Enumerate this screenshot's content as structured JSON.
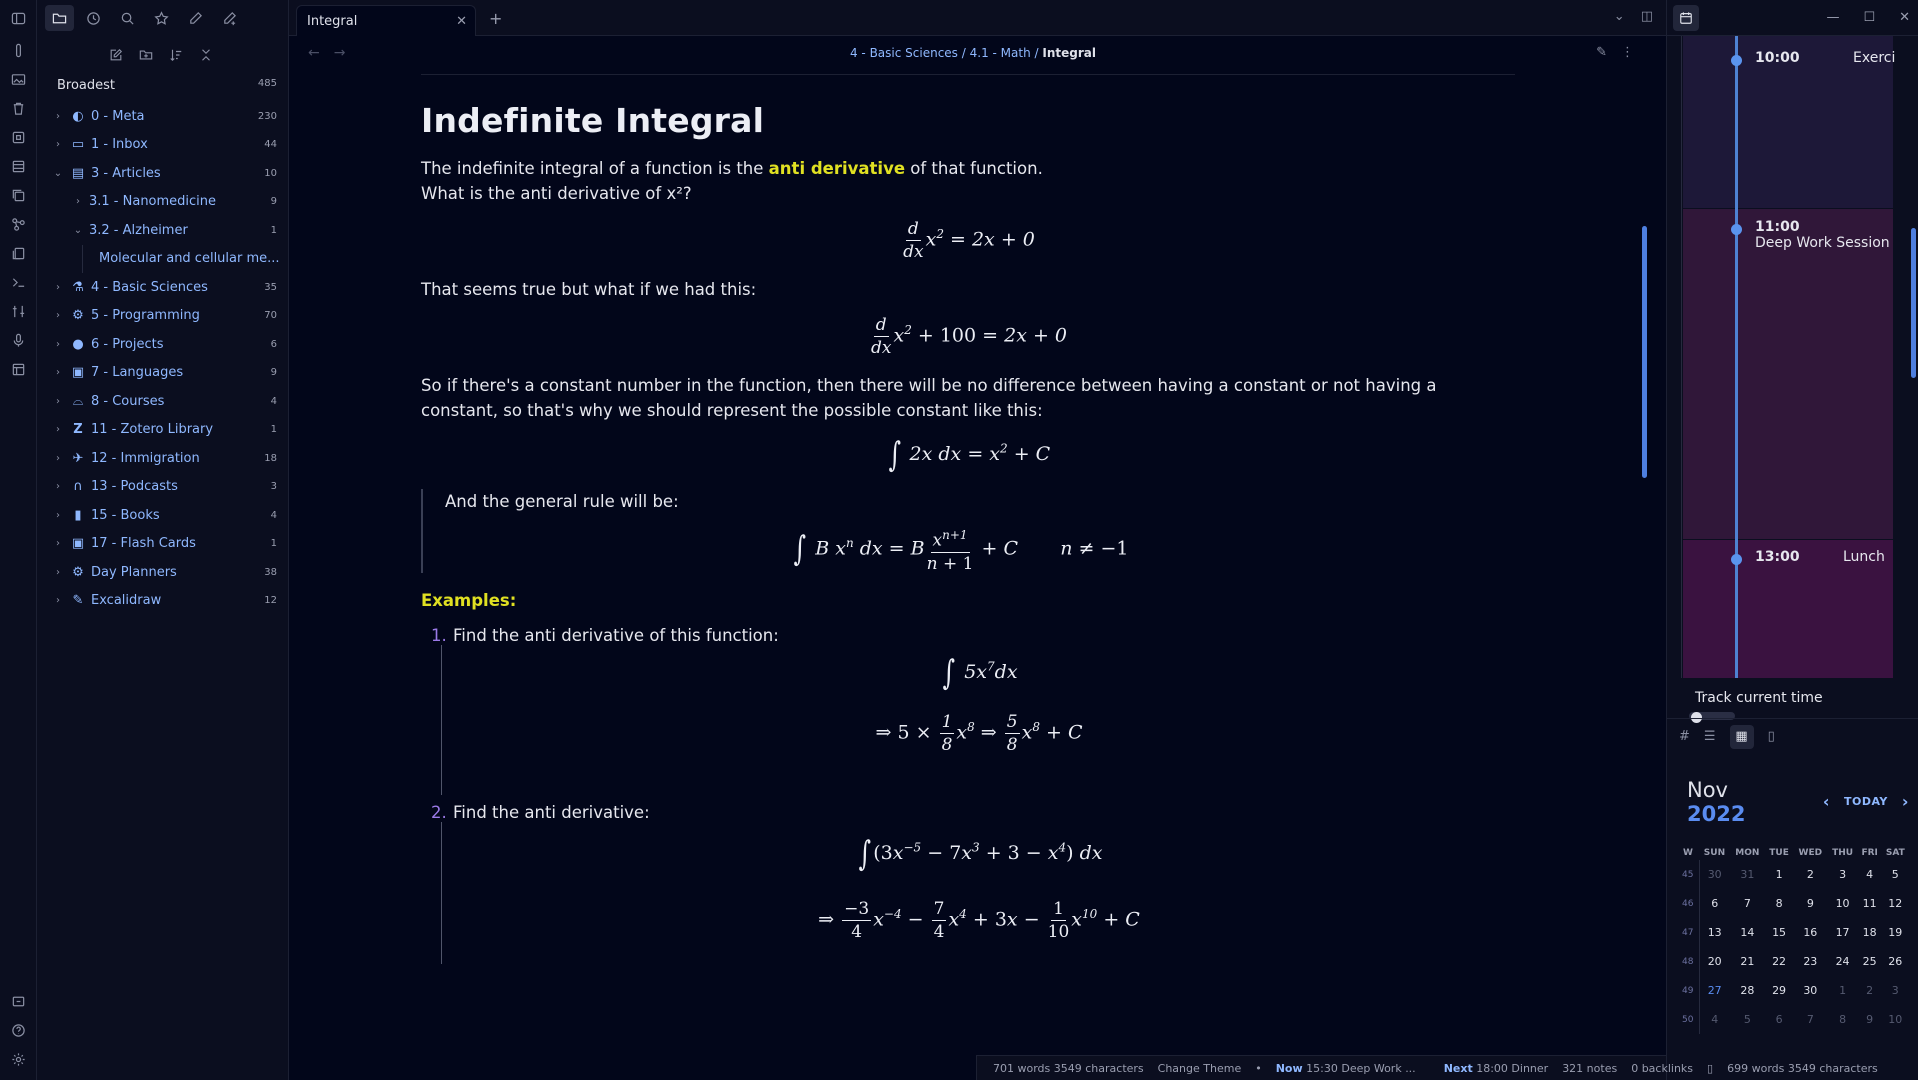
{
  "tab": {
    "title": "Integral"
  },
  "breadcrumb": {
    "part1": "4 - Basic Sciences",
    "sep": "/",
    "part2": "4.1 - Math",
    "current": "Integral"
  },
  "vault": {
    "name": "Broadest",
    "count": "485"
  },
  "tree": [
    {
      "label": "0 - Meta",
      "count": "230",
      "icon": "brain-icon"
    },
    {
      "label": "1 - Inbox",
      "count": "44",
      "icon": "inbox-icon"
    },
    {
      "label": "3 - Articles",
      "count": "10",
      "icon": "newspaper-icon"
    },
    {
      "label": "3.1 - Nanomedicine",
      "count": "9"
    },
    {
      "label": "3.2 - Alzheimer",
      "count": "1"
    },
    {
      "label": "Molecular and cellular me..."
    },
    {
      "label": "4 - Basic Sciences",
      "count": "35",
      "icon": "flask-icon"
    },
    {
      "label": "5 - Programming",
      "count": "70",
      "icon": "python-icon"
    },
    {
      "label": "6 - Projects",
      "count": "6",
      "icon": "github-icon"
    },
    {
      "label": "7 - Languages",
      "count": "9",
      "icon": "language-icon"
    },
    {
      "label": "8 - Courses",
      "count": "4",
      "icon": "binoculars-icon"
    },
    {
      "label": "11 - Zotero Library",
      "count": "1",
      "icon": "zotero-icon"
    },
    {
      "label": "12 - Immigration",
      "count": "18",
      "icon": "plane-icon"
    },
    {
      "label": "13 - Podcasts",
      "count": "3",
      "icon": "headphones-icon"
    },
    {
      "label": "15 - Books",
      "count": "4",
      "icon": "book-icon"
    },
    {
      "label": "17 - Flash Cards",
      "count": "1",
      "icon": "flashcard-icon"
    },
    {
      "label": "Day Planners",
      "count": "38",
      "icon": "gear-icon"
    },
    {
      "label": "Excalidraw",
      "count": "12",
      "icon": "pen-icon"
    }
  ],
  "note": {
    "title": "Indefinite Integral",
    "p1a": "The indefinite integral of a function is the ",
    "p1hl": "anti derivative",
    "p1b": " of that function.",
    "p2": "What is the anti derivative of x²?",
    "p3": "That seems true but what if we had this:",
    "p4": "So if there's a constant number in the function, then there will be no difference between having a constant or not having a constant, so that's why we should represent the possible constant like this:",
    "quote": "And the general rule will be:",
    "examples": "Examples:",
    "item1": "Find the anti derivative of this function:",
    "item2": "Find the anti derivative:",
    "n1": "1.",
    "n2": "2."
  },
  "planner": {
    "events": [
      {
        "time": "10:00",
        "name": "Exercise"
      },
      {
        "time": "11:00",
        "name": "Deep Work Session"
      },
      {
        "time": "13:00",
        "name": "Lunch"
      }
    ],
    "track_label": "Track current time"
  },
  "calendar": {
    "month": "Nov",
    "year": "2022",
    "today": "TODAY",
    "headers": [
      "W",
      "SUN",
      "MON",
      "TUE",
      "WED",
      "THU",
      "FRI",
      "SAT"
    ],
    "weeks": [
      [
        "45",
        "30",
        "31",
        "1",
        "2",
        "3",
        "4",
        "5"
      ],
      [
        "46",
        "6",
        "7",
        "8",
        "9",
        "10",
        "11",
        "12"
      ],
      [
        "47",
        "13",
        "14",
        "15",
        "16",
        "17",
        "18",
        "19"
      ],
      [
        "48",
        "20",
        "21",
        "22",
        "23",
        "24",
        "25",
        "26"
      ],
      [
        "49",
        "27",
        "28",
        "29",
        "30",
        "1",
        "2",
        "3"
      ],
      [
        "50",
        "4",
        "5",
        "6",
        "7",
        "8",
        "9",
        "10"
      ]
    ]
  },
  "status": {
    "words": "701 words 3549 characters",
    "theme": "Change Theme",
    "now_label": "Now",
    "now_value": "15:30 Deep Work ...",
    "next_label": "Next",
    "next_value": "18:00 Dinner",
    "notes": "321 notes",
    "backlinks": "0 backlinks",
    "words2": "699 words 3549 characters"
  },
  "colors": {
    "accent": "#5a8cf0",
    "highlight": "#e0e022",
    "folder": "#8fb8ff"
  }
}
